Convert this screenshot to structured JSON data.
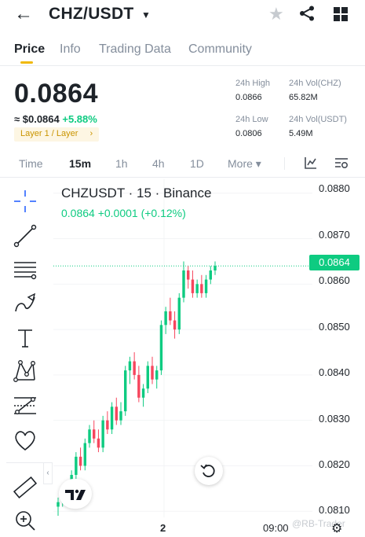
{
  "header": {
    "back_icon": "arrow-left-icon",
    "pair": "CHZ/USDT",
    "pair_caret": "▼",
    "star_icon": "star-icon",
    "share_icon": "share-icon",
    "apps_icon": "grid-icon"
  },
  "tabs": [
    {
      "label": "Price",
      "active": true
    },
    {
      "label": "Info",
      "active": false
    },
    {
      "label": "Trading Data",
      "active": false
    },
    {
      "label": "Community",
      "active": false
    }
  ],
  "ticker": {
    "price": "0.0864",
    "usd_value": "≈ $0.0864",
    "change": "+5.88%",
    "tag": "Layer 1 / Layer",
    "tag_arrow": "›",
    "high_label": "24h High",
    "high_value": "0.0866",
    "low_label": "24h Low",
    "low_value": "0.0806",
    "vol_base_label": "24h Vol(CHZ)",
    "vol_base_value": "65.82M",
    "vol_quote_label": "24h Vol(USDT)",
    "vol_quote_value": "5.49M"
  },
  "intervals": [
    {
      "label": "Time",
      "active": false
    },
    {
      "label": "15m",
      "active": true
    },
    {
      "label": "1h",
      "active": false
    },
    {
      "label": "4h",
      "active": false
    },
    {
      "label": "1D",
      "active": false
    },
    {
      "label": "More ▾",
      "active": false
    }
  ],
  "toolbar_icons": [
    "crosshair-icon",
    "trend-line-icon",
    "horizontal-lines-icon",
    "brush-icon",
    "text-icon",
    "pattern-icon",
    "fib-icon",
    "heart-icon",
    "ruler-icon",
    "zoom-in-icon"
  ],
  "chart": {
    "title": "CHZUSDT · 15 · Binance",
    "ohlc": "0.0864  +0.0001 (+0.12%)",
    "current_price_tag": "0.0864",
    "watermark": "@RB-Trader",
    "colors": {
      "up": "#0ecb81",
      "down": "#f6465d",
      "accent": "#f0b90b"
    }
  },
  "chart_data": {
    "type": "candlestick",
    "title": "CHZUSDT · 15 · Binance",
    "y_ticks": [
      "0.0880",
      "0.0870",
      "0.0860",
      "0.0850",
      "0.0840",
      "0.0830",
      "0.0820",
      "0.0810"
    ],
    "x_ticks": [
      "2",
      "09:00"
    ],
    "ylim": [
      0.0809,
      0.0881
    ],
    "last_price": 0.0864,
    "candles": [
      [
        0.0811,
        0.0813,
        0.0809,
        0.0812
      ],
      [
        0.0812,
        0.0815,
        0.0811,
        0.0814
      ],
      [
        0.0814,
        0.0816,
        0.0812,
        0.0813
      ],
      [
        0.0813,
        0.0819,
        0.0812,
        0.0818
      ],
      [
        0.0818,
        0.0823,
        0.0817,
        0.0822
      ],
      [
        0.0822,
        0.0824,
        0.0819,
        0.082
      ],
      [
        0.082,
        0.0826,
        0.0819,
        0.0825
      ],
      [
        0.0825,
        0.0829,
        0.0824,
        0.0828
      ],
      [
        0.0828,
        0.083,
        0.0825,
        0.0826
      ],
      [
        0.0826,
        0.0828,
        0.0823,
        0.0824
      ],
      [
        0.0824,
        0.0831,
        0.0823,
        0.083
      ],
      [
        0.083,
        0.0832,
        0.0827,
        0.0828
      ],
      [
        0.0828,
        0.0834,
        0.0827,
        0.0833
      ],
      [
        0.0833,
        0.0835,
        0.0829,
        0.083
      ],
      [
        0.083,
        0.0834,
        0.0829,
        0.0832
      ],
      [
        0.0832,
        0.0842,
        0.0831,
        0.0841
      ],
      [
        0.0841,
        0.0844,
        0.0838,
        0.0843
      ],
      [
        0.0843,
        0.0845,
        0.0839,
        0.084
      ],
      [
        0.084,
        0.0842,
        0.0834,
        0.0835
      ],
      [
        0.0835,
        0.0838,
        0.0833,
        0.0837
      ],
      [
        0.0837,
        0.0843,
        0.0836,
        0.0842
      ],
      [
        0.0842,
        0.0844,
        0.0838,
        0.0839
      ],
      [
        0.0839,
        0.0842,
        0.0837,
        0.0841
      ],
      [
        0.0841,
        0.0852,
        0.084,
        0.0851
      ],
      [
        0.0851,
        0.0855,
        0.0849,
        0.0854
      ],
      [
        0.0854,
        0.0857,
        0.0851,
        0.0852
      ],
      [
        0.0852,
        0.0854,
        0.0848,
        0.085
      ],
      [
        0.085,
        0.0858,
        0.0849,
        0.0857
      ],
      [
        0.0857,
        0.0865,
        0.0856,
        0.0863
      ],
      [
        0.0863,
        0.0864,
        0.0859,
        0.0861
      ],
      [
        0.0861,
        0.0863,
        0.0857,
        0.0858
      ],
      [
        0.0858,
        0.0861,
        0.0857,
        0.086
      ],
      [
        0.086,
        0.0862,
        0.0857,
        0.0858
      ],
      [
        0.0858,
        0.0862,
        0.0857,
        0.0861
      ],
      [
        0.0861,
        0.0864,
        0.086,
        0.0863
      ],
      [
        0.0863,
        0.0865,
        0.0862,
        0.0864
      ]
    ]
  }
}
